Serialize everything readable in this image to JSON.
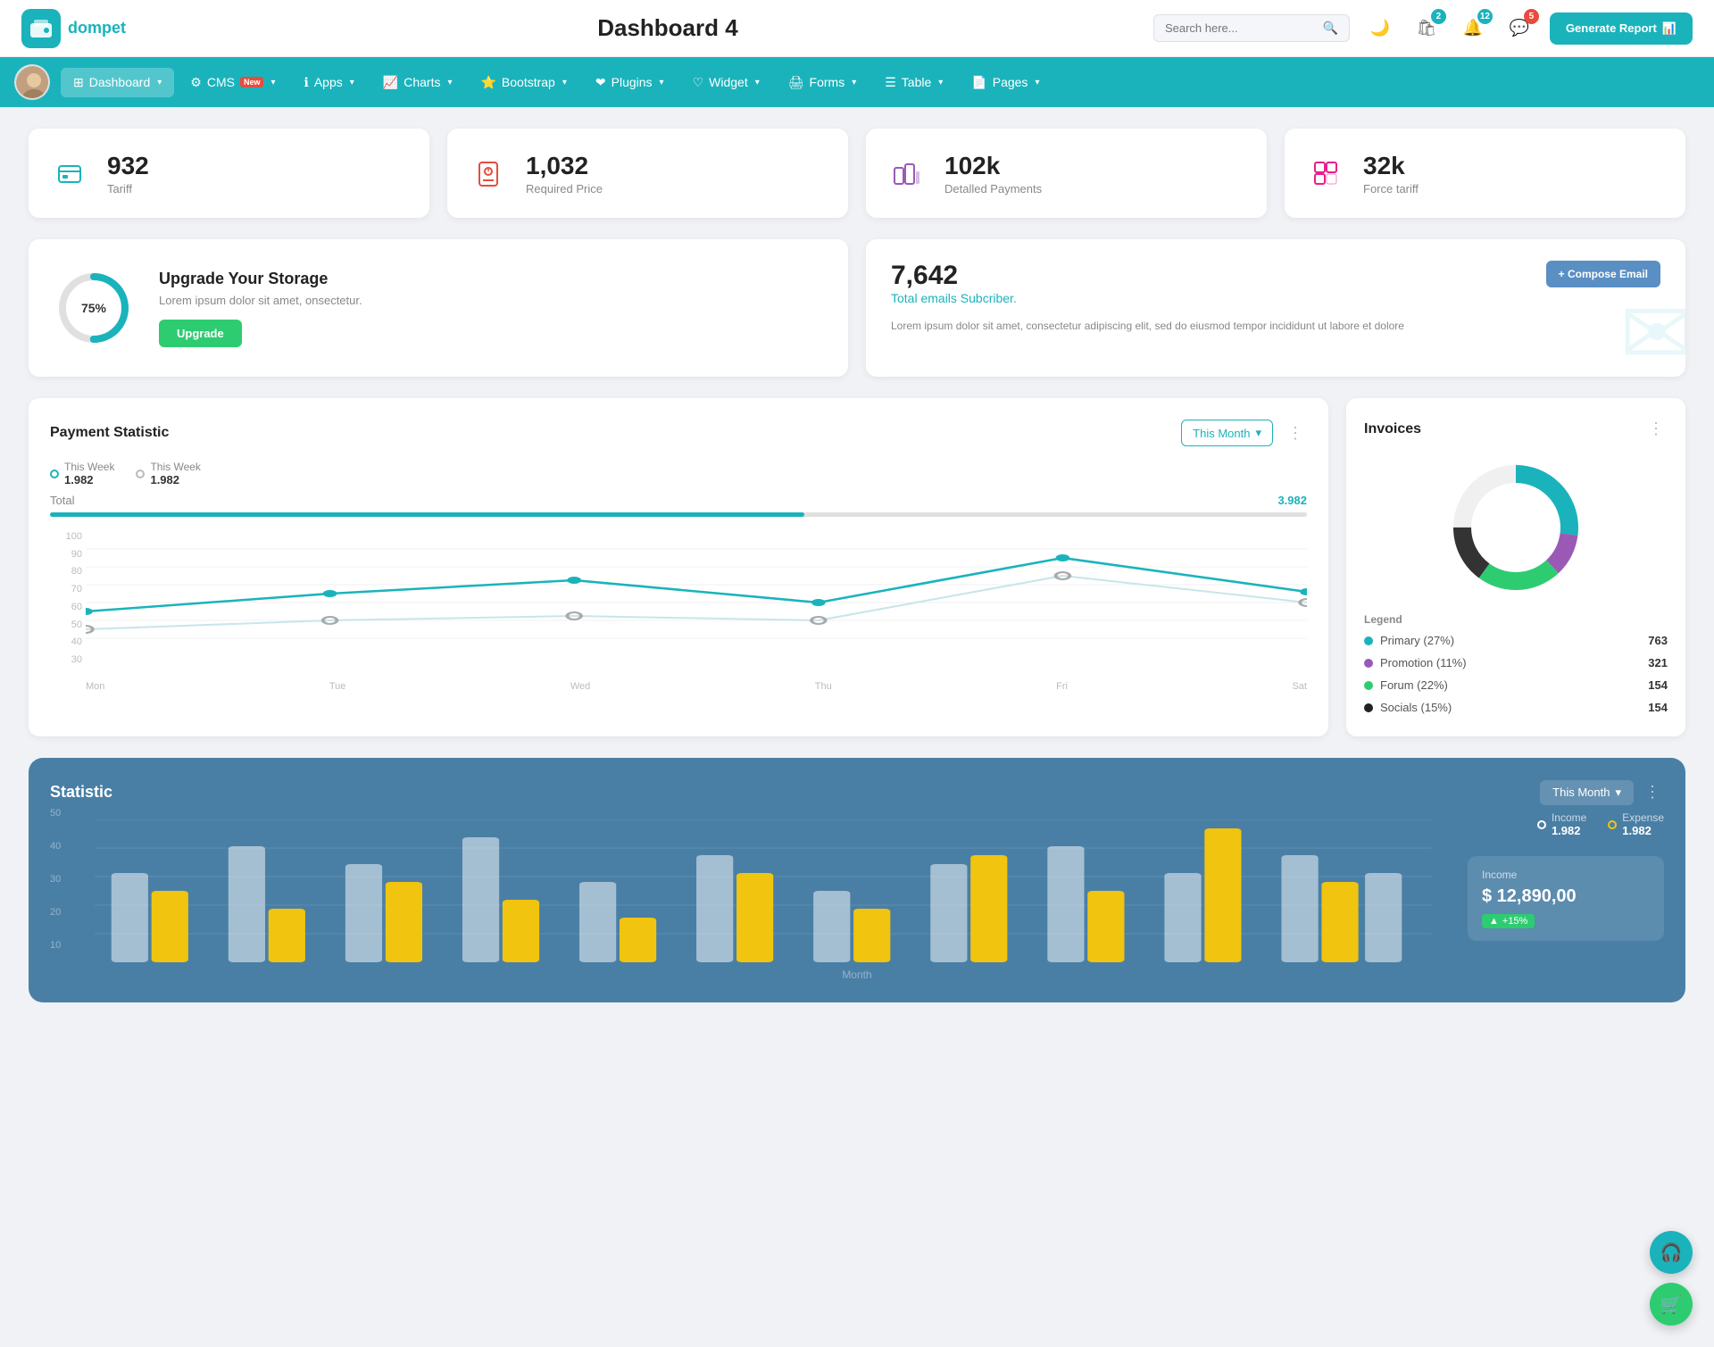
{
  "header": {
    "logo_text": "dompet",
    "title": "Dashboard 4",
    "search_placeholder": "Search here...",
    "generate_btn": "Generate Report",
    "badges": {
      "shop": "2",
      "bell": "12",
      "chat": "5"
    }
  },
  "nav": {
    "items": [
      {
        "label": "Dashboard",
        "active": true
      },
      {
        "label": "CMS",
        "badge": "New"
      },
      {
        "label": "Apps"
      },
      {
        "label": "Charts"
      },
      {
        "label": "Bootstrap"
      },
      {
        "label": "Plugins"
      },
      {
        "label": "Widget"
      },
      {
        "label": "Forms"
      },
      {
        "label": "Table"
      },
      {
        "label": "Pages"
      }
    ]
  },
  "stat_cards": [
    {
      "value": "932",
      "label": "Tariff",
      "icon_type": "teal"
    },
    {
      "value": "1,032",
      "label": "Required Price",
      "icon_type": "red"
    },
    {
      "value": "102k",
      "label": "Detalled Payments",
      "icon_type": "purple"
    },
    {
      "value": "32k",
      "label": "Force tariff",
      "icon_type": "pink"
    }
  ],
  "storage": {
    "percent": "75%",
    "title": "Upgrade Your Storage",
    "description": "Lorem ipsum dolor sit amet, onsectetur.",
    "btn_label": "Upgrade"
  },
  "email": {
    "count": "7,642",
    "subtitle": "Total emails Subcriber.",
    "description": "Lorem ipsum dolor sit amet, consectetur adipiscing elit, sed do eiusmod tempor incididunt ut labore et dolore",
    "compose_btn": "+ Compose Email"
  },
  "payment": {
    "title": "Payment Statistic",
    "period": "This Month",
    "legend1_label": "This Week",
    "legend1_val": "1.982",
    "legend2_label": "This Week",
    "legend2_val": "1.982",
    "total_label": "Total",
    "total_val": "3.982",
    "y_labels": [
      "100",
      "90",
      "80",
      "70",
      "60",
      "50",
      "40",
      "30"
    ],
    "x_labels": [
      "Mon",
      "Tue",
      "Wed",
      "Thu",
      "Fri",
      "Sat"
    ],
    "line1_points": "40,140 200,120 360,110 520,130 680,80 840,120",
    "line2_points": "40,160 200,150 360,140 520,145 680,90 840,115"
  },
  "invoices": {
    "title": "Invoices",
    "legend_title": "Legend",
    "items": [
      {
        "label": "Primary (27%)",
        "value": "763",
        "color": "#1ab3bc"
      },
      {
        "label": "Promotion (11%)",
        "value": "321",
        "color": "#9b59b6"
      },
      {
        "label": "Forum (22%)",
        "value": "154",
        "color": "#2ecc71"
      },
      {
        "label": "Socials (15%)",
        "value": "154",
        "color": "#222"
      }
    ]
  },
  "statistic": {
    "title": "Statistic",
    "period": "This Month",
    "income_label": "Income",
    "income_val": "1.982",
    "expense_label": "Expense",
    "expense_val": "1.982",
    "income_panel_label": "Income",
    "income_panel_value": "$ 12,890,00",
    "income_badge": "+15%",
    "y_labels": [
      "50",
      "40",
      "30",
      "20",
      "10"
    ],
    "month_label": "Month"
  }
}
